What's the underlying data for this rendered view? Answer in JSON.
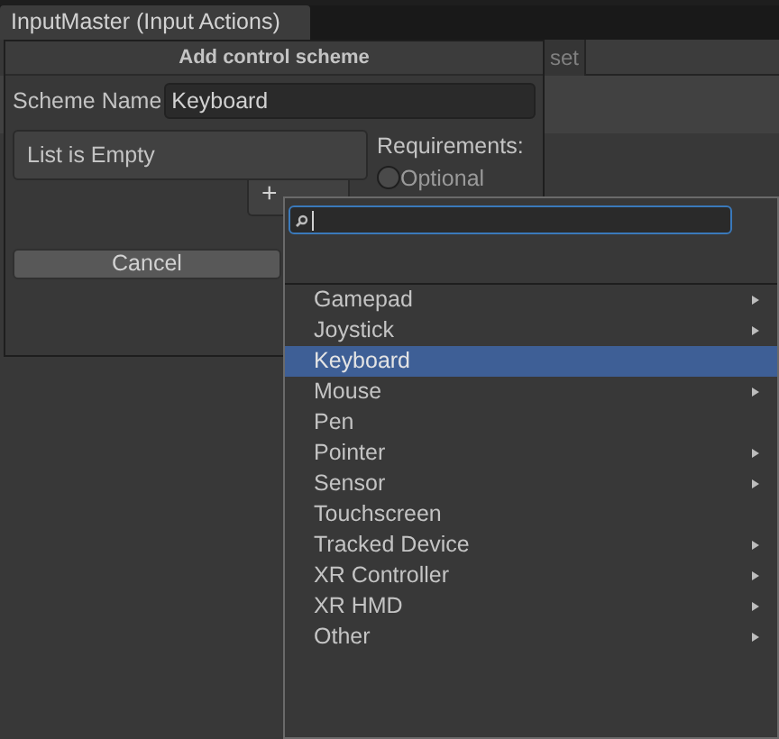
{
  "window": {
    "title": "InputMaster (Input Actions)"
  },
  "background_tab": {
    "label": "set"
  },
  "dialog": {
    "title": "Add control scheme",
    "scheme_name_label": "Scheme Name",
    "scheme_name_value": "Keyboard",
    "list_empty_text": "List is Empty",
    "add_button": "+",
    "requirements_label": "Requirements:",
    "optional_radio": {
      "label": "Optional",
      "selected": false
    },
    "cancel_button": "Cancel"
  },
  "device_popup": {
    "items": [
      {
        "label": "Gamepad",
        "has_submenu": true,
        "selected": false
      },
      {
        "label": "Joystick",
        "has_submenu": true,
        "selected": false
      },
      {
        "label": "Keyboard",
        "has_submenu": false,
        "selected": true
      },
      {
        "label": "Mouse",
        "has_submenu": true,
        "selected": false
      },
      {
        "label": "Pen",
        "has_submenu": false,
        "selected": false
      },
      {
        "label": "Pointer",
        "has_submenu": true,
        "selected": false
      },
      {
        "label": "Sensor",
        "has_submenu": true,
        "selected": false
      },
      {
        "label": "Touchscreen",
        "has_submenu": false,
        "selected": false
      },
      {
        "label": "Tracked Device",
        "has_submenu": true,
        "selected": false
      },
      {
        "label": "XR Controller",
        "has_submenu": true,
        "selected": false
      },
      {
        "label": "XR HMD",
        "has_submenu": true,
        "selected": false
      },
      {
        "label": "Other",
        "has_submenu": true,
        "selected": false
      }
    ]
  }
}
